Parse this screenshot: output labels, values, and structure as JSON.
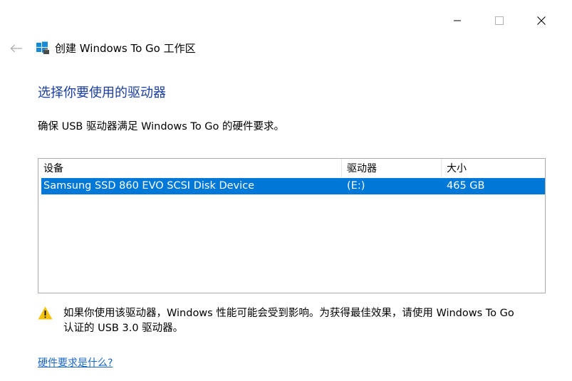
{
  "window": {
    "title": "创建 Windows To Go 工作区",
    "icons": {
      "app": "windows-logo-usb-icon",
      "back": "back-arrow-icon",
      "minimize": "minimize-icon",
      "maximize": "maximize-icon",
      "close": "close-icon"
    }
  },
  "page": {
    "heading": "选择你要使用的驱动器",
    "instruction": "确保 USB 驱动器满足 Windows To Go 的硬件要求。"
  },
  "drive_list": {
    "columns": [
      "设备",
      "驱动器",
      "大小"
    ],
    "rows": [
      {
        "device": "Samsung SSD 860 EVO SCSI Disk Device",
        "drive": "(E:)",
        "size": "465 GB",
        "selected": true
      }
    ]
  },
  "warning": {
    "icon": "warning-triangle-icon",
    "text": "如果你使用该驱动器，Windows 性能可能会受到影响。为获得最佳效果，请使用 Windows To Go 认证的 USB 3.0 驱动器。"
  },
  "help_link": "硬件要求是什么?",
  "colors": {
    "heading": "#1a3e9f",
    "selection": "#0078d7",
    "link": "#1a66c5",
    "warning": "#f4c20d"
  }
}
